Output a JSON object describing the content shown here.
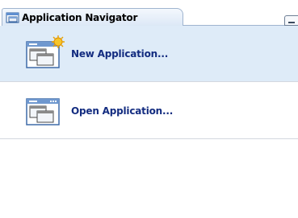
{
  "navigator": {
    "tab_title": "Application Navigator",
    "tab_icon": "application-navigator-icon",
    "minimize_icon": "minimize-icon",
    "items": [
      {
        "label": "New Application...",
        "icon": "new-application-icon",
        "selected": true
      },
      {
        "label": "Open Application...",
        "icon": "open-application-icon",
        "selected": false
      }
    ]
  },
  "colors": {
    "selected_row": "#deebf8",
    "link_text": "#132c80",
    "tab_border": "#9fb4cf"
  }
}
